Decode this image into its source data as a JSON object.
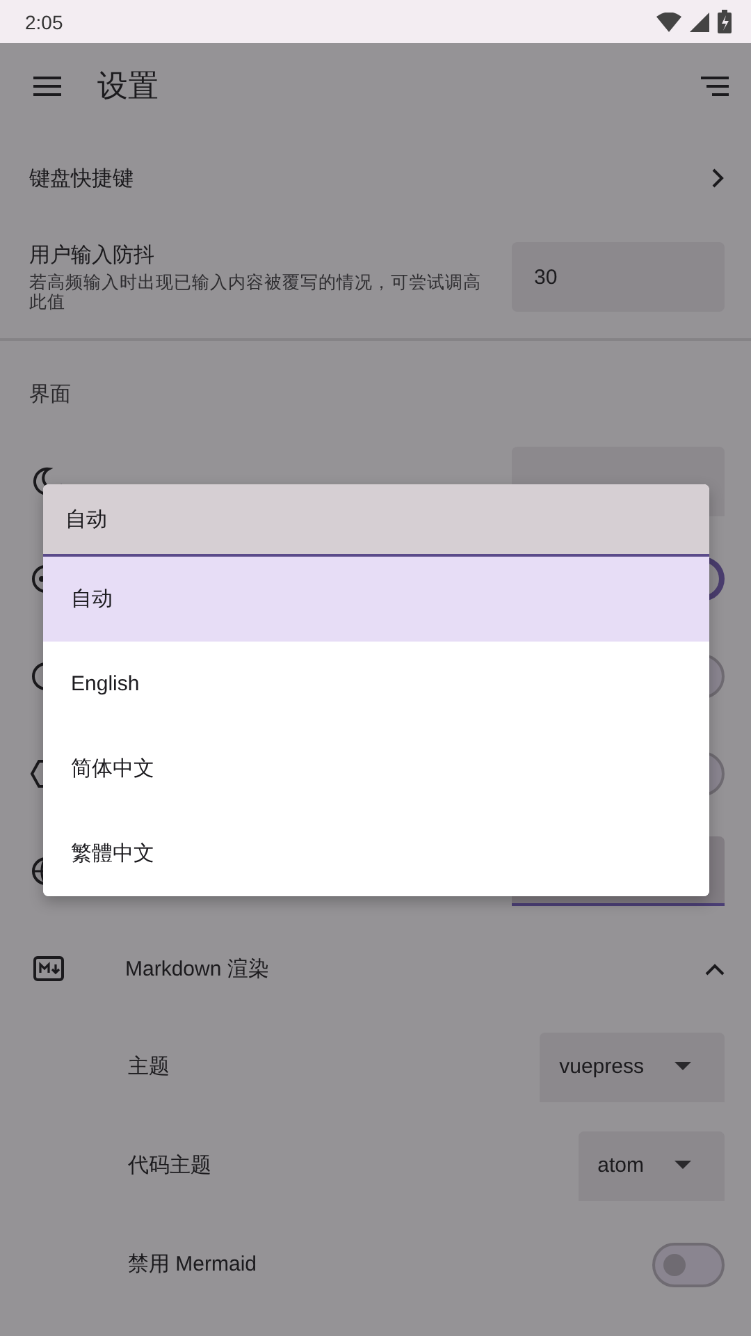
{
  "status_bar": {
    "time": "2:05"
  },
  "app_bar": {
    "title": "设置"
  },
  "general": [
    {
      "kind": "link",
      "label": "键盘快捷键"
    },
    {
      "kind": "number",
      "label": "用户输入防抖",
      "description": "若高频输入时出现已输入内容被覆写的情况，可尝试调高此值",
      "value": "30"
    }
  ],
  "section": {
    "title": "界面"
  },
  "interface_rows": [
    {
      "kind": "select",
      "focused": false
    },
    {
      "kind": "switch",
      "on": true
    },
    {
      "kind": "switch",
      "on": false
    },
    {
      "kind": "switch",
      "on": false
    },
    {
      "kind": "select",
      "focused": true
    }
  ],
  "markdown": {
    "title": "Markdown 渲染",
    "expanded": true,
    "rows": [
      {
        "kind": "select",
        "label": "主题",
        "value": "vuepress"
      },
      {
        "kind": "select",
        "label": "代码主题",
        "value": "atom"
      },
      {
        "kind": "switch",
        "label": "禁用 Mermaid",
        "on": false
      }
    ]
  },
  "language_menu": {
    "value": "自动",
    "options": [
      {
        "label": "自动",
        "selected": true
      },
      {
        "label": "English",
        "selected": false
      },
      {
        "label": "简体中文",
        "selected": false
      },
      {
        "label": "繁體中文",
        "selected": false
      }
    ]
  }
}
